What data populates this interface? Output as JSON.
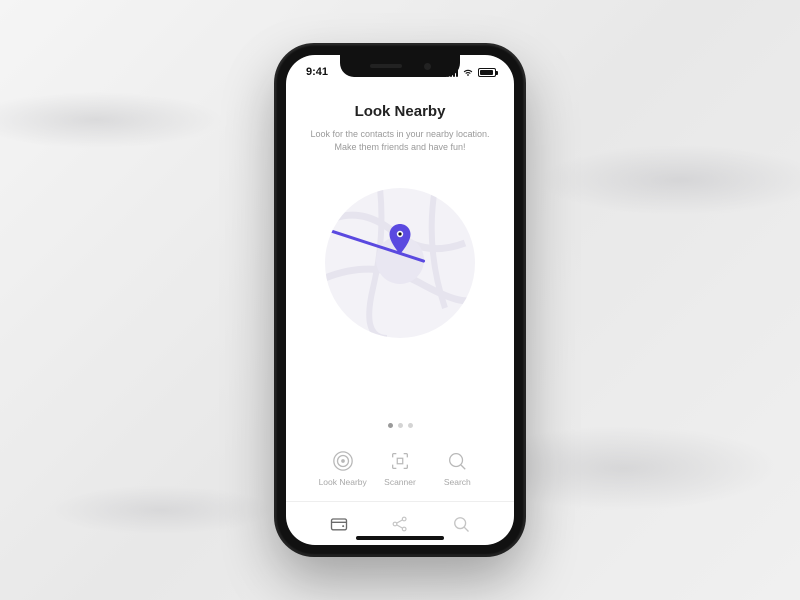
{
  "status": {
    "time": "9:41"
  },
  "header": {
    "title": "Look Nearby",
    "subtitle_line1": "Look for the contacts in your nearby location.",
    "subtitle_line2": "Make them friends and have fun!"
  },
  "carousel": {
    "count": 3,
    "active_index": 0
  },
  "actions": [
    {
      "id": "look-nearby",
      "label": "Look Nearby",
      "icon": "radar-icon"
    },
    {
      "id": "scanner",
      "label": "Scanner",
      "icon": "scan-icon"
    },
    {
      "id": "search",
      "label": "Search",
      "icon": "search-circle-icon"
    }
  ],
  "bottom_nav": [
    {
      "id": "wallet",
      "icon": "wallet-icon",
      "active": true
    },
    {
      "id": "share",
      "icon": "share-icon",
      "active": false
    },
    {
      "id": "search",
      "icon": "search-icon",
      "active": false
    }
  ],
  "colors": {
    "accent": "#5a49e0"
  }
}
